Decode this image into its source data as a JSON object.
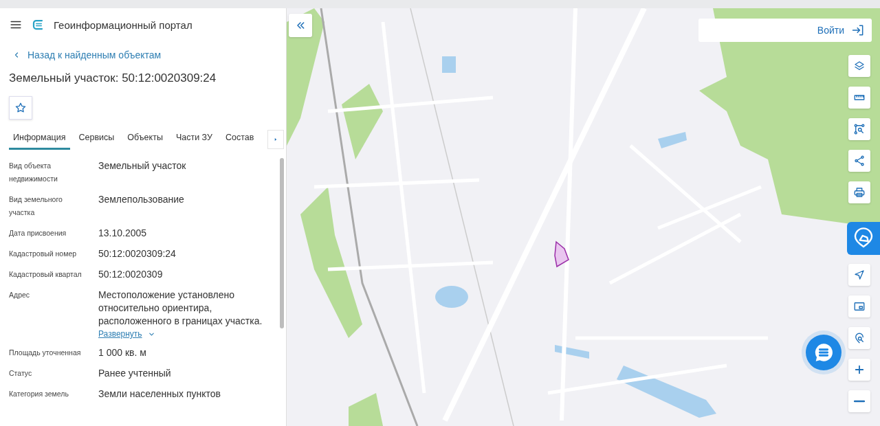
{
  "header": {
    "title": "Геоинформационный портал"
  },
  "back_link": "Назад к найденным объектам",
  "title": "Земельный участок: 50:12:0020309:24",
  "tabs": [
    {
      "label": "Информация",
      "selected": true
    },
    {
      "label": "Сервисы",
      "selected": false
    },
    {
      "label": "Объекты",
      "selected": false
    },
    {
      "label": "Части ЗУ",
      "selected": false
    },
    {
      "label": "Состав",
      "selected": false
    }
  ],
  "properties": [
    {
      "label": "Вид объекта недвижимости",
      "value": "Земельный участок"
    },
    {
      "label": "Вид земельного участка",
      "value": "Землепользование"
    },
    {
      "label": "Дата присвоения",
      "value": "13.10.2005"
    },
    {
      "label": "Кадастровый номер",
      "value": "50:12:0020309:24"
    },
    {
      "label": "Кадастровый квартал",
      "value": "50:12:0020309"
    },
    {
      "label": "Адрес",
      "value": "Местоположение установлено относительно ориентира, расположенного в границах участка.",
      "expand_link": "Развернуть"
    },
    {
      "label": "Площадь уточненная",
      "value": "1 000 кв. м"
    },
    {
      "label": "Статус",
      "value": "Ранее учтенный"
    },
    {
      "label": "Категория земель",
      "value": "Земли населенных пунктов"
    }
  ],
  "map": {
    "login_label": "Войти"
  }
}
